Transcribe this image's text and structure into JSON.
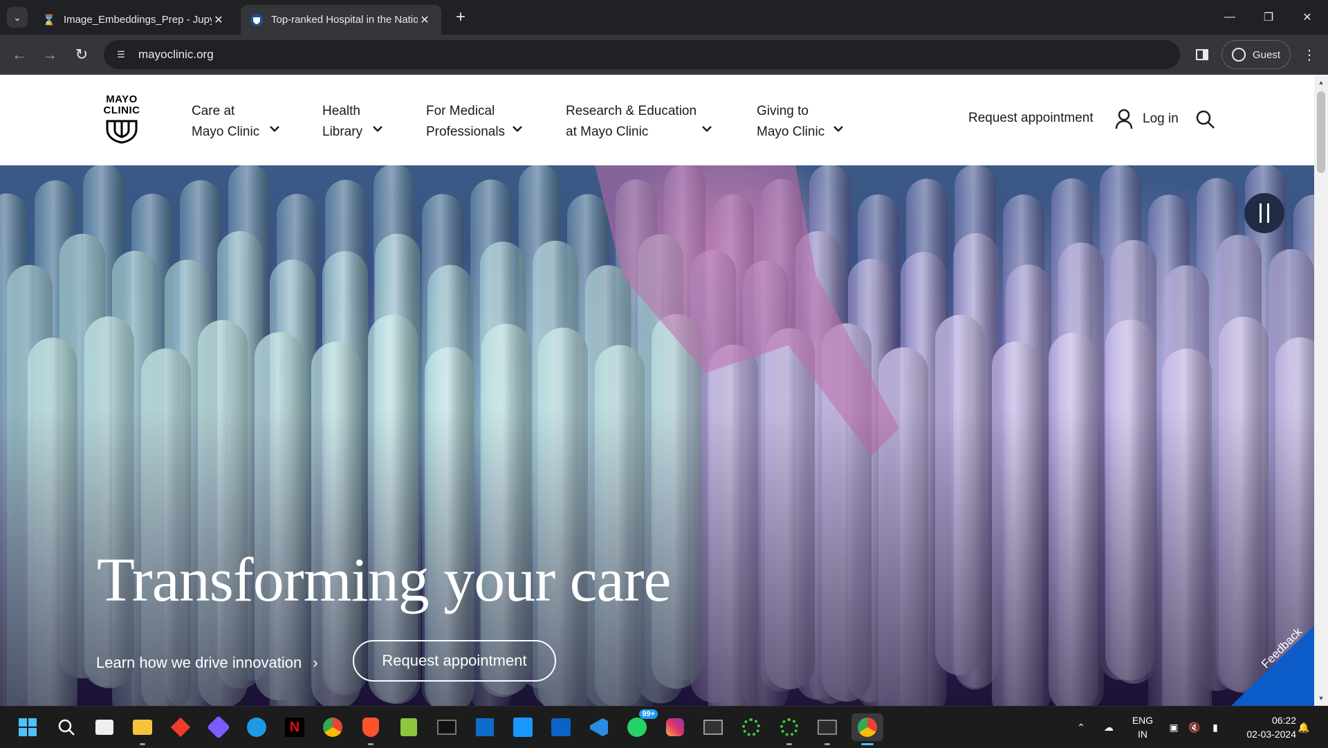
{
  "browser": {
    "tabs": [
      {
        "title": "Image_Embeddings_Prep - Jupyter",
        "favicon": "hourglass-icon",
        "active": false
      },
      {
        "title": "Top-ranked Hospital in the Nation",
        "favicon": "mayo-shield-icon",
        "active": true
      }
    ],
    "url": "mayoclinic.org",
    "profile_label": "Guest"
  },
  "site": {
    "logo": {
      "line1": "MAYO",
      "line2": "CLINIC"
    },
    "nav": [
      {
        "line1": "Care at",
        "line2": "Mayo Clinic"
      },
      {
        "line1": "Health",
        "line2": "Library"
      },
      {
        "line1": "For Medical",
        "line2": "Professionals"
      },
      {
        "line1": "Research & Education",
        "line2": "at Mayo Clinic"
      },
      {
        "line1": "Giving to",
        "line2": "Mayo Clinic"
      }
    ],
    "request_appointment": "Request appointment",
    "login": "Log in"
  },
  "hero": {
    "title": "Transforming your care",
    "link": "Learn how we drive innovation",
    "button": "Request appointment",
    "feedback": "Feedback"
  },
  "taskbar": {
    "apps": [
      "start-icon",
      "search-icon",
      "store-icon",
      "file-explorer-icon",
      "anydesk-icon",
      "copilot-icon",
      "edge-icon",
      "netflix-icon",
      "chrome-icon",
      "brave-icon",
      "notepad-icon",
      "terminal-icon",
      "sticky-icon",
      "prime-video-icon",
      "outlook-icon",
      "vscode-icon",
      "whatsapp-icon",
      "instagram-icon",
      "window-icon",
      "spinner-icon",
      "spinner2-icon",
      "powershell-icon",
      "chrome-active-icon"
    ],
    "whatsapp_badge": "99+",
    "lang_line1": "ENG",
    "lang_line2": "IN",
    "time": "06:22",
    "date": "02-03-2024"
  }
}
